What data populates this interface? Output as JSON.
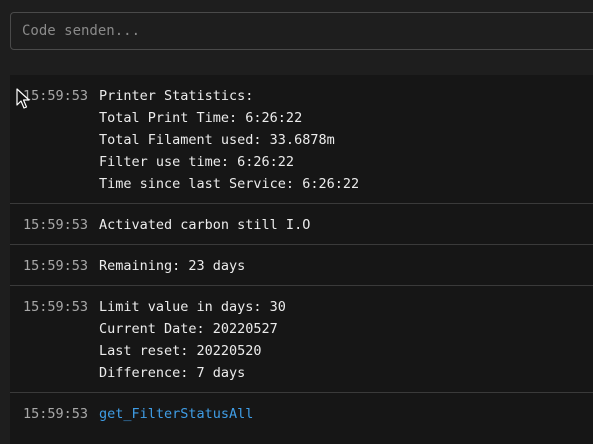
{
  "command": {
    "placeholder": "Code senden...",
    "value": ""
  },
  "console": {
    "entries": [
      {
        "time": "15:59:53",
        "lines": [
          "Printer Statistics:",
          "Total Print Time: 6:26:22",
          "Total Filament used: 33.6878m",
          "Filter use time: 6:26:22",
          "Time since last Service: 6:26:22"
        ]
      },
      {
        "time": "15:59:53",
        "lines": [
          "Activated carbon still I.O"
        ]
      },
      {
        "time": "15:59:53",
        "lines": [
          "Remaining: 23 days"
        ]
      },
      {
        "time": "15:59:53",
        "lines": [
          "Limit value in days: 30",
          "Current Date: 20220527",
          "Last reset: 20220520",
          "Difference: 7 days"
        ]
      },
      {
        "time": "15:59:53",
        "lines": [
          "get_FilterStatusAll"
        ],
        "is_command": true
      }
    ]
  },
  "colors": {
    "background": "#1e1e1e",
    "console_background": "#161616",
    "command_link": "#3f9de6",
    "timestamp": "#a8a8a8"
  }
}
